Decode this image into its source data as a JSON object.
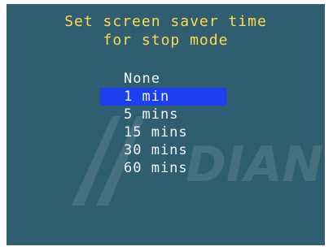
{
  "title_lines": [
    "Set screen saver time",
    "for stop mode"
  ],
  "options": [
    "None",
    "1 min",
    "5 mins",
    "15 mins",
    "30 mins",
    "60 mins"
  ],
  "selected_index": 1,
  "watermark_text": "DIAN",
  "colors": {
    "background": "#2f5e70",
    "title": "#ffd94a",
    "option_text": "#f3f3f3",
    "highlight": "#1c3ff0"
  }
}
